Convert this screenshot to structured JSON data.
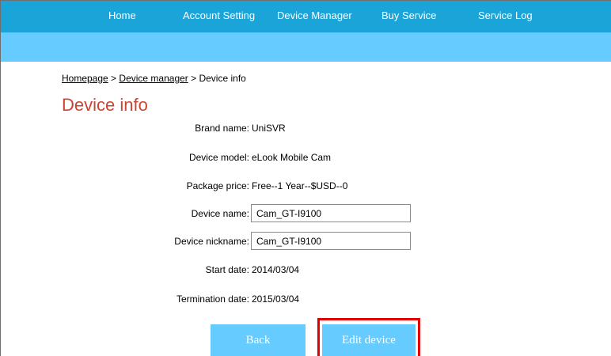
{
  "nav": {
    "items": [
      "Home",
      "Account Setting",
      "Device Manager",
      "Buy Service",
      "Service Log"
    ]
  },
  "breadcrumb": {
    "home": "Homepage",
    "sep1": " > ",
    "manager": "Device manager",
    "sep2": " > ",
    "current": "Device info"
  },
  "page": {
    "title": "Device info"
  },
  "fields": {
    "brand": {
      "label": "Brand name:",
      "value": "UniSVR"
    },
    "model": {
      "label": "Device model:",
      "value": "eLook Mobile Cam"
    },
    "package": {
      "label": "Package price:",
      "value": "Free--1 Year--$USD--0"
    },
    "device_name": {
      "label": "Device name:",
      "value": "Cam_GT-I9100"
    },
    "nickname": {
      "label": "Device nickname:",
      "value": "Cam_GT-I9100"
    },
    "start": {
      "label": "Start date:",
      "value": "2014/03/04"
    },
    "termination": {
      "label": "Termination date:",
      "value": "2015/03/04"
    }
  },
  "buttons": {
    "back": "Back",
    "edit": "Edit device"
  },
  "colors": {
    "nav_bg": "#1aa4d8",
    "subbar_bg": "#66ccff",
    "title": "#cc4433",
    "button_bg": "#66ccff",
    "highlight": "#e00000"
  }
}
